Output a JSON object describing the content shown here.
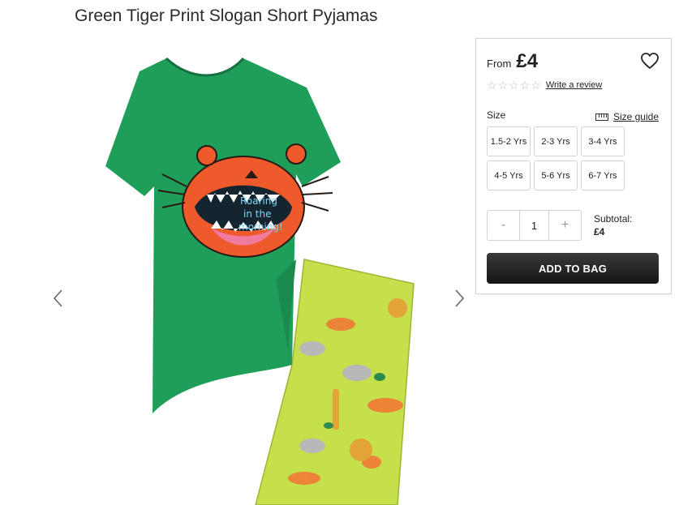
{
  "product": {
    "title": "Green Tiger Print Slogan Short Pyjamas",
    "image_slogan": [
      "Roaring",
      "in the",
      "morning!"
    ]
  },
  "gallery": {
    "prev_icon": "chevron-left-icon",
    "next_icon": "chevron-right-icon"
  },
  "panel": {
    "from_label": "From",
    "price": "£4",
    "wishlist_icon": "heart-icon",
    "rating": {
      "stars": 0,
      "max": 5
    },
    "review_link": "Write a review",
    "size_label": "Size",
    "size_guide_label": "Size guide",
    "size_guide_icon": "ruler-icon",
    "sizes": [
      "1.5-2 Yrs",
      "2-3 Yrs",
      "3-4 Yrs",
      "4-5 Yrs",
      "5-6 Yrs",
      "6-7 Yrs"
    ],
    "quantity": {
      "minus": "-",
      "value": "1",
      "plus": "+"
    },
    "subtotal_label": "Subtotal:",
    "subtotal_value": "£4",
    "add_to_bag": "ADD TO BAG"
  },
  "colors": {
    "shirt": "#1f9e5a",
    "tiger": "#ee5a2c",
    "shorts": "#c5e04b",
    "button": "#222222"
  }
}
